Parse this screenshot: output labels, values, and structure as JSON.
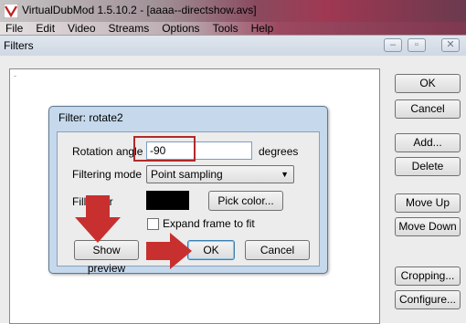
{
  "app": {
    "title": "VirtualDubMod 1.5.10.2 - [aaaa--directshow.avs]",
    "menu": [
      "File",
      "Edit",
      "Video",
      "Streams",
      "Options",
      "Tools",
      "Help"
    ]
  },
  "filters_window": {
    "title": "Filters",
    "list_marker": "-",
    "buttons": {
      "ok": "OK",
      "cancel": "Cancel",
      "add": "Add...",
      "delete": "Delete",
      "move_up": "Move Up",
      "move_down": "Move Down",
      "cropping": "Cropping...",
      "configure": "Configure..."
    }
  },
  "dialog": {
    "title": "Filter: rotate2",
    "rotation_angle_label": "Rotation angle",
    "rotation_angle_value": "-90",
    "rotation_unit": "degrees",
    "filtering_mode_label": "Filtering mode",
    "filtering_mode_value": "Point sampling",
    "fill_color_label": "Fill color",
    "fill_color": "#000000",
    "pick_color_label": "Pick color...",
    "expand_frame_label": "Expand frame to fit",
    "expand_frame_checked": false,
    "show_preview_label": "Show preview",
    "ok_label": "OK",
    "cancel_label": "Cancel"
  },
  "annotations": {
    "highlight_color": "#b02a2a",
    "arrow_color": "#c83030"
  },
  "icons": {
    "app": "virtualdub-logo-icon",
    "minimize": "minimize-icon",
    "maximize": "maximize-icon",
    "close": "close-icon",
    "dropdown": "chevron-down-icon"
  }
}
